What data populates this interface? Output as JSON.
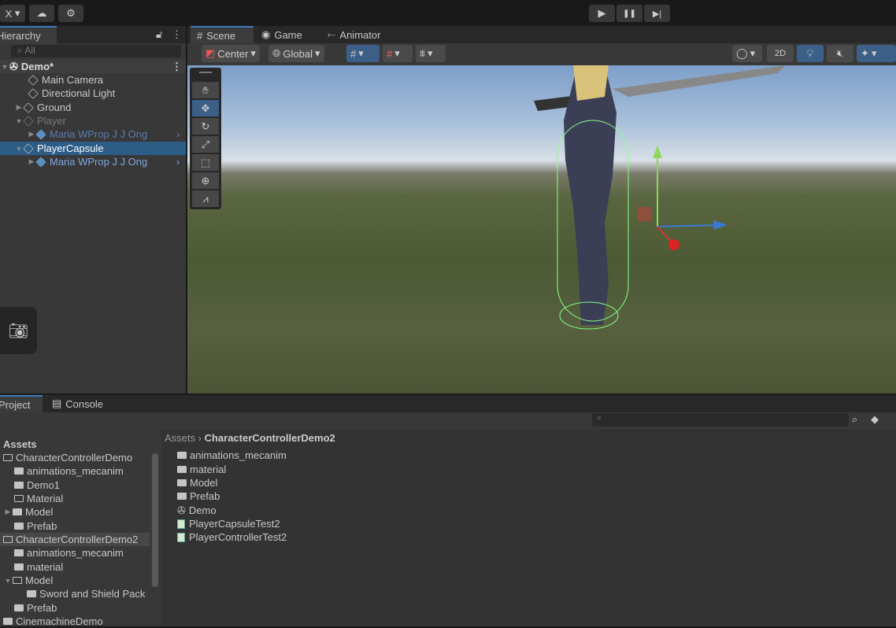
{
  "toolbar": {
    "account": "X",
    "cloud_icon": "cloud-icon",
    "collab_icon": "gear-icon",
    "play": "▶",
    "pause": "❚❚",
    "step": "▶|"
  },
  "hierarchy": {
    "tab": "Hierarchy",
    "search_placeholder": "All",
    "scene": "Demo*",
    "items": [
      {
        "label": "Main Camera"
      },
      {
        "label": "Directional Light"
      },
      {
        "label": "Ground"
      },
      {
        "label": "Player"
      },
      {
        "label": "Maria WProp J J Ong"
      },
      {
        "label": "PlayerCapsule"
      },
      {
        "label": "Maria WProp J J Ong"
      }
    ]
  },
  "scene": {
    "tabs": [
      "Scene",
      "Game",
      "Animator"
    ],
    "pivot": "Center",
    "space": "Global",
    "mode2d": "2D"
  },
  "bottom": {
    "tabs": [
      "Project",
      "Console"
    ],
    "tree": [
      {
        "label": "Assets"
      },
      {
        "label": "CharacterControllerDemo"
      },
      {
        "label": "animations_mecanim"
      },
      {
        "label": "Demo1"
      },
      {
        "label": "Material"
      },
      {
        "label": "Model"
      },
      {
        "label": "Prefab"
      },
      {
        "label": "CharacterControllerDemo2"
      },
      {
        "label": "animations_mecanim"
      },
      {
        "label": "material"
      },
      {
        "label": "Model"
      },
      {
        "label": "Sword and Shield Pack"
      },
      {
        "label": "Prefab"
      },
      {
        "label": "CinemachineDemo"
      }
    ],
    "breadcrumb": [
      "Assets",
      "CharacterControllerDemo2"
    ],
    "files": [
      {
        "label": "animations_mecanim",
        "type": "folder"
      },
      {
        "label": "material",
        "type": "folder"
      },
      {
        "label": "Model",
        "type": "folder"
      },
      {
        "label": "Prefab",
        "type": "folder"
      },
      {
        "label": "Demo",
        "type": "scene"
      },
      {
        "label": "PlayerCapsuleTest2",
        "type": "script"
      },
      {
        "label": "PlayerControllerTest2",
        "type": "script"
      }
    ]
  },
  "colors": {
    "accent": "#3b5f87",
    "selection": "#2c5d87",
    "prefab_text": "#7fa6e0"
  }
}
